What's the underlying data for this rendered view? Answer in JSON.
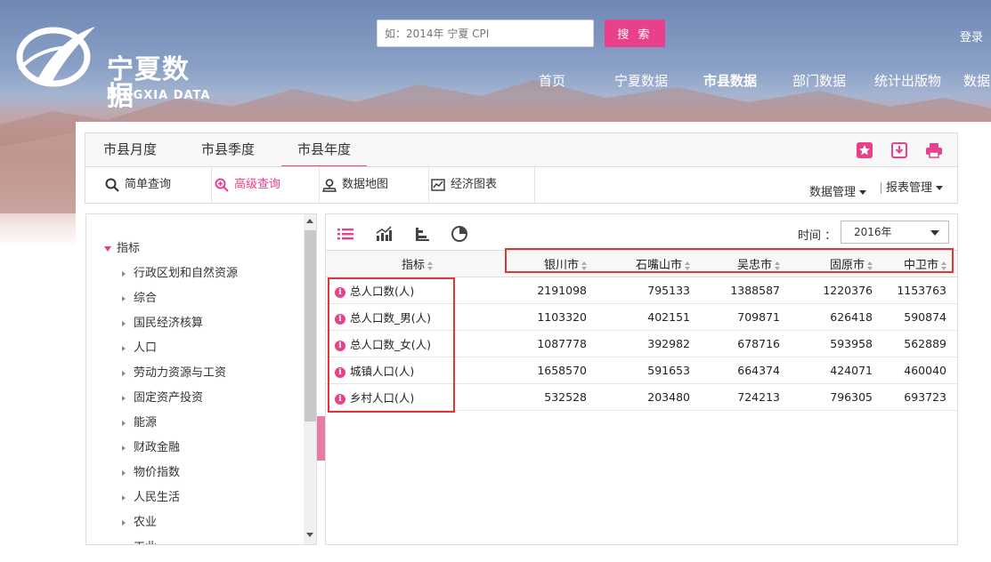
{
  "brand": {
    "name_cn": "宁夏数据",
    "name_en": "NINGXIA DATA"
  },
  "search": {
    "placeholder": "如：2014年 宁夏 CPI",
    "button": "搜 索"
  },
  "login": "登录",
  "nav": [
    "首页",
    "宁夏数据",
    "市县数据",
    "部门数据",
    "统计出版物",
    "数据"
  ],
  "tabs": [
    "市县月度",
    "市县季度",
    "市县年度"
  ],
  "active_tab": "市县年度",
  "toolbar": {
    "tools": [
      "简单查询",
      "高级查询",
      "数据地图",
      "经济图表"
    ],
    "data_mgmt": "数据管理",
    "report_mgmt": "报表管理"
  },
  "tree": {
    "root": "指标",
    "items": [
      "行政区划和自然资源",
      "综合",
      "国民经济核算",
      "人口",
      "劳动力资源与工资",
      "固定资产投资",
      "能源",
      "财政金融",
      "物价指数",
      "人民生活",
      "农业",
      "工业"
    ]
  },
  "time": {
    "label": "时间 ：",
    "value": "2016年"
  },
  "table": {
    "indicator_header": "指标",
    "columns": [
      "银川市",
      "石嘴山市",
      "吴忠市",
      "固原市",
      "中卫市"
    ],
    "rows": [
      {
        "name": "总人口数(人)",
        "values": [
          "2191098",
          "795133",
          "1388587",
          "1220376",
          "1153763"
        ]
      },
      {
        "name": "总人口数_男(人)",
        "values": [
          "1103320",
          "402151",
          "709871",
          "626418",
          "590874"
        ]
      },
      {
        "name": "总人口数_女(人)",
        "values": [
          "1087778",
          "392982",
          "678716",
          "593958",
          "562889"
        ]
      },
      {
        "name": "城镇人口(人)",
        "values": [
          "1658570",
          "591653",
          "664374",
          "424071",
          "460040"
        ]
      },
      {
        "name": "乡村人口(人)",
        "values": [
          "532528",
          "203480",
          "724213",
          "796305",
          "693723"
        ]
      }
    ]
  },
  "colors": {
    "accent": "#e8408a",
    "highlight": "#e53238"
  }
}
